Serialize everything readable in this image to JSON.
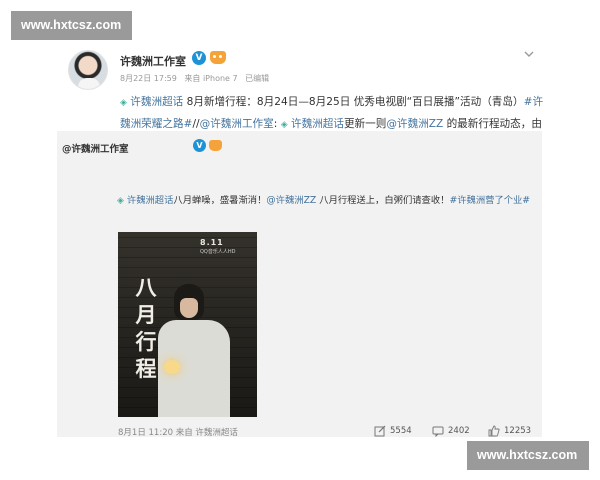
{
  "watermark": {
    "top": "www.hxtcsz.com",
    "bottom": "www.hxtcsz.com"
  },
  "post": {
    "username": "许魏洲工作室",
    "verified_badge": "V",
    "meta": {
      "date": "8月22日 17:59",
      "source": "来自 iPhone 7",
      "edited": "已编辑"
    },
    "text": {
      "tag1": "许魏洲超话",
      "seg1": " 8月新增行程：8月24日—8月25日 优秀电视剧“百日展播”活动（青岛）",
      "tag2": "#许魏洲荣耀之路#",
      "seg2": "//",
      "mention1": "@许魏洲工作室",
      "seg3": ": ",
      "tag3": "许魏洲超话",
      "seg4": "更新一则",
      "mention2": "@许魏洲ZZ",
      "seg5": " 的最新行程动态，由于台风等天气原因，今晚品牌的公开活动取消，白粥们注意安全，特殊天气尽量减少出行！"
    }
  },
  "repost": {
    "author": "@许魏洲工作室",
    "verified_badge": "V",
    "text": {
      "tag1": "许魏洲超话",
      "seg1": "八月蝉噪，盛暑渐消！",
      "mention": "@许魏洲ZZ",
      "seg2": " 八月行程送上，白粥们请查收！",
      "tag2": "#许魏洲营了个业#"
    },
    "poster": {
      "date": "8.11",
      "sub": "QQ音乐人人HD",
      "title": "八月行程"
    },
    "footer": {
      "date": "8月1日 11:20",
      "source": "来自 许魏洲超话"
    },
    "stats": {
      "reposts": "5554",
      "comments": "2402",
      "likes": "12253"
    }
  },
  "icons": {
    "chevron": "chevron-down-icon",
    "supertopic": "diamond-icon",
    "repost": "edit-repost-icon",
    "comment": "comment-icon",
    "like": "thumbs-up-icon"
  },
  "colors": {
    "link": "#45749e",
    "verified": "#1d93d6",
    "repost_bg": "#f2f2f2"
  }
}
